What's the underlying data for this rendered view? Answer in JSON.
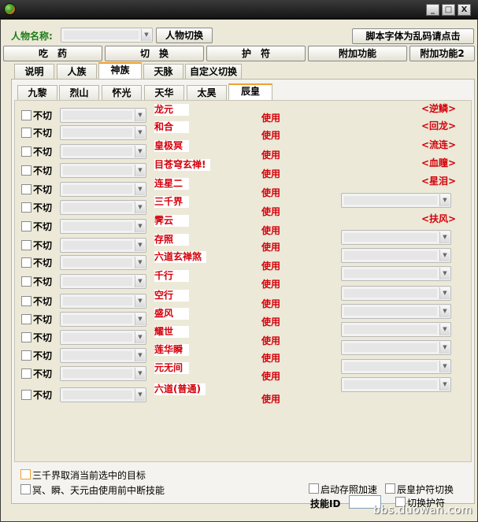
{
  "window": {
    "controls": [
      "_",
      "□",
      "X"
    ]
  },
  "toolbar": {
    "character_label": "人物名称:",
    "switch_char_button": "人物切换",
    "garbled_font_button": "脚本字体为乱码请点击"
  },
  "main_buttons": [
    "吃　药",
    "切　换",
    "护　符",
    "附加功能",
    "附加功能2"
  ],
  "tabs": [
    "说明",
    "人族",
    "神族",
    "天脉",
    "自定义切换"
  ],
  "active_tab": "神族",
  "subtabs": [
    "九黎",
    "烈山",
    "怀光",
    "天华",
    "太昊",
    "辰皇"
  ],
  "active_subtab": "辰皇",
  "rows": [
    {
      "cb_label": "不切",
      "skill": "龙元",
      "use": "使用"
    },
    {
      "cb_label": "不切",
      "skill": "和合",
      "use": "使用"
    },
    {
      "cb_label": "不切",
      "skill": "皇极冥",
      "use": "使用"
    },
    {
      "cb_label": "不切",
      "skill": "目苍穹玄禅!",
      "use": "使用"
    },
    {
      "cb_label": "不切",
      "skill": "连星二",
      "use": "使用"
    },
    {
      "cb_label": "不切",
      "skill": "三千界",
      "use": "使用"
    },
    {
      "cb_label": "不切",
      "skill": "霁云",
      "use": "使用"
    },
    {
      "cb_label": "不切",
      "skill": "存照",
      "use": "使用"
    },
    {
      "cb_label": "不切",
      "skill": "六道玄禅煞",
      "use": "使用"
    },
    {
      "cb_label": "不切",
      "skill": "千行",
      "use": "使用"
    },
    {
      "cb_label": "不切",
      "skill": "空行",
      "use": "使用"
    },
    {
      "cb_label": "不切",
      "skill": "盛风",
      "use": "使用"
    },
    {
      "cb_label": "不切",
      "skill": "耀世",
      "use": "使用"
    },
    {
      "cb_label": "不切",
      "skill": "莲华瞬",
      "use": "使用"
    },
    {
      "cb_label": "不切",
      "skill": "元无间",
      "use": "使用"
    },
    {
      "cb_label": "不切",
      "skill": "六道(普通)",
      "use": "使用"
    }
  ],
  "right_labels": [
    "<逆鳞>",
    "<回龙>",
    "<流连>",
    "<血瞳>",
    "<星泪>",
    "<扶风>"
  ],
  "bottom": {
    "opt1": "三千界取消当前选中的目标",
    "opt2": "冥、瞬、天元由使用前中断技能",
    "opt3": "启动存照加速",
    "opt4": "辰皇护符切换",
    "skill_id_label": "技能ID",
    "opt5": "切换护符"
  },
  "watermark": "bbs.duowan.com",
  "colors": {
    "accent_red": "#d4000a",
    "label_green": "#1d7d18",
    "active_tab_border": "#f0a030"
  }
}
